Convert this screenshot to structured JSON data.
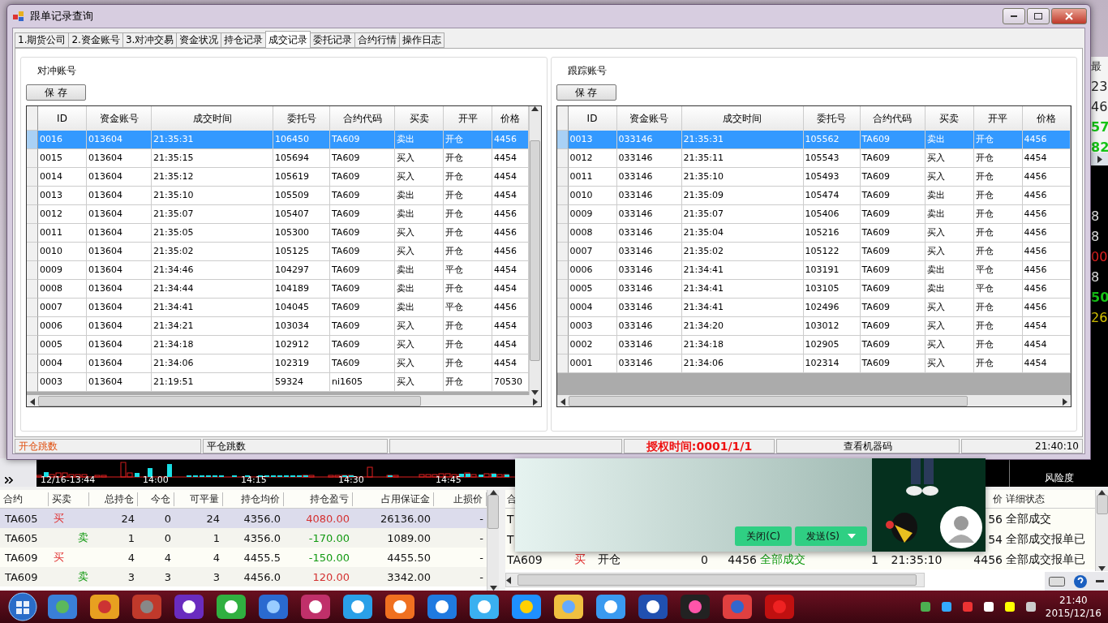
{
  "background_app": {
    "right_strip": {
      "header": "最",
      "values": [
        {
          "text": "23",
          "kind": "plain"
        },
        {
          "text": "46",
          "kind": "plain"
        },
        {
          "text": "57",
          "kind": "up"
        },
        {
          "text": "82",
          "kind": "up"
        }
      ],
      "lower_values": [
        {
          "text": "8",
          "kind": "plain"
        },
        {
          "text": "8",
          "kind": "plain"
        },
        {
          "text": "00",
          "kind": "down"
        },
        {
          "text": "8",
          "kind": "plain"
        },
        {
          "text": "50",
          "kind": "up"
        },
        {
          "text": "26",
          "kind": "warn"
        }
      ]
    },
    "chart": {
      "time_labels": [
        "12/16-13:44",
        "14:00",
        "14:15",
        "14:30",
        "14:45"
      ]
    },
    "risk_label": "风险度",
    "positions": {
      "columns": [
        "合约",
        "买卖",
        "总持仓",
        "今仓",
        "可平量",
        "持仓均价",
        "持仓盈亏",
        "占用保证金",
        "止损价"
      ],
      "rows": [
        {
          "selected": true,
          "cells": [
            {
              "text": "TA605",
              "kind": "plain"
            },
            {
              "text": "买",
              "kind": "buy"
            },
            {
              "text": "24",
              "kind": "plain"
            },
            {
              "text": "0",
              "kind": "plain"
            },
            {
              "text": "24",
              "kind": "plain"
            },
            {
              "text": "4356.0",
              "kind": "plain"
            },
            {
              "text": "4080.00",
              "kind": "profit"
            },
            {
              "text": "26136.00",
              "kind": "plain"
            },
            {
              "text": "-",
              "kind": "plain"
            }
          ]
        },
        {
          "selected": false,
          "cells": [
            {
              "text": "TA605",
              "kind": "plain"
            },
            {
              "text": "卖",
              "kind": "sell"
            },
            {
              "text": "1",
              "kind": "plain"
            },
            {
              "text": "0",
              "kind": "plain"
            },
            {
              "text": "1",
              "kind": "plain"
            },
            {
              "text": "4356.0",
              "kind": "plain"
            },
            {
              "text": "-170.00",
              "kind": "loss"
            },
            {
              "text": "1089.00",
              "kind": "plain"
            },
            {
              "text": "-",
              "kind": "plain"
            }
          ]
        },
        {
          "selected": false,
          "cells": [
            {
              "text": "TA609",
              "kind": "plain"
            },
            {
              "text": "买",
              "kind": "buy"
            },
            {
              "text": "4",
              "kind": "plain"
            },
            {
              "text": "4",
              "kind": "plain"
            },
            {
              "text": "4",
              "kind": "plain"
            },
            {
              "text": "4455.5",
              "kind": "plain"
            },
            {
              "text": "-150.00",
              "kind": "loss"
            },
            {
              "text": "4455.50",
              "kind": "plain"
            },
            {
              "text": "-",
              "kind": "plain"
            }
          ]
        },
        {
          "selected": false,
          "cells": [
            {
              "text": "TA609",
              "kind": "plain"
            },
            {
              "text": "卖",
              "kind": "sell"
            },
            {
              "text": "3",
              "kind": "plain"
            },
            {
              "text": "3",
              "kind": "plain"
            },
            {
              "text": "3",
              "kind": "plain"
            },
            {
              "text": "4456.0",
              "kind": "plain"
            },
            {
              "text": "120.00",
              "kind": "profit"
            },
            {
              "text": "3342.00",
              "kind": "plain"
            },
            {
              "text": "-",
              "kind": "plain"
            }
          ]
        }
      ]
    },
    "orders": {
      "columns": [
        "合",
        null,
        null,
        null,
        null,
        null,
        null,
        null,
        "价",
        "详细状态"
      ],
      "rows": [
        {
          "cells": [
            "T",
            null,
            null,
            null,
            null,
            null,
            null,
            null,
            "56",
            "全部成交"
          ]
        },
        {
          "cells": [
            "T",
            null,
            null,
            null,
            null,
            null,
            null,
            null,
            "54",
            "全部成交报单已"
          ]
        },
        {
          "cells": [
            "TA609",
            "买",
            "开仓",
            "0",
            "4456",
            "全部成交",
            "1",
            "21:35:10",
            "4456",
            "全部成交报单已"
          ]
        }
      ]
    }
  },
  "dialog": {
    "title": "跟单记录查询",
    "tabs": [
      {
        "label": "1.期货公司",
        "selected": false
      },
      {
        "label": "2.资金账号",
        "selected": false
      },
      {
        "label": "3.对冲交易",
        "selected": false
      },
      {
        "label": "资金状况",
        "selected": false
      },
      {
        "label": "持仓记录",
        "selected": false
      },
      {
        "label": "成交记录",
        "selected": true
      },
      {
        "label": "委托记录",
        "selected": false
      },
      {
        "label": "合约行情",
        "selected": false
      },
      {
        "label": "操作日志",
        "selected": false
      }
    ],
    "panels": [
      {
        "label": "对冲账号",
        "save_button": "保 存",
        "vertical_scroll": true,
        "columns": [
          "ID",
          "资金账号",
          "成交时间",
          "委托号",
          "合约代码",
          "买卖",
          "开平",
          "价格"
        ],
        "rows": [
          {
            "selected": true,
            "cells": [
              "0016",
              "013604",
              "21:35:31",
              "106450",
              "TA609",
              "卖出",
              "开仓",
              "4456"
            ]
          },
          {
            "selected": false,
            "cells": [
              "0015",
              "013604",
              "21:35:15",
              "105694",
              "TA609",
              "买入",
              "开仓",
              "4454"
            ]
          },
          {
            "selected": false,
            "cells": [
              "0014",
              "013604",
              "21:35:12",
              "105619",
              "TA609",
              "买入",
              "开仓",
              "4454"
            ]
          },
          {
            "selected": false,
            "cells": [
              "0013",
              "013604",
              "21:35:10",
              "105509",
              "TA609",
              "卖出",
              "开仓",
              "4454"
            ]
          },
          {
            "selected": false,
            "cells": [
              "0012",
              "013604",
              "21:35:07",
              "105407",
              "TA609",
              "卖出",
              "开仓",
              "4456"
            ]
          },
          {
            "selected": false,
            "cells": [
              "0011",
              "013604",
              "21:35:05",
              "105300",
              "TA609",
              "买入",
              "开仓",
              "4456"
            ]
          },
          {
            "selected": false,
            "cells": [
              "0010",
              "013604",
              "21:35:02",
              "105125",
              "TA609",
              "买入",
              "开仓",
              "4456"
            ]
          },
          {
            "selected": false,
            "cells": [
              "0009",
              "013604",
              "21:34:46",
              "104297",
              "TA609",
              "卖出",
              "平仓",
              "4454"
            ]
          },
          {
            "selected": false,
            "cells": [
              "0008",
              "013604",
              "21:34:44",
              "104189",
              "TA609",
              "卖出",
              "开仓",
              "4454"
            ]
          },
          {
            "selected": false,
            "cells": [
              "0007",
              "013604",
              "21:34:41",
              "104045",
              "TA609",
              "卖出",
              "平仓",
              "4456"
            ]
          },
          {
            "selected": false,
            "cells": [
              "0006",
              "013604",
              "21:34:21",
              "103034",
              "TA609",
              "买入",
              "开仓",
              "4454"
            ]
          },
          {
            "selected": false,
            "cells": [
              "0005",
              "013604",
              "21:34:18",
              "102912",
              "TA609",
              "买入",
              "开仓",
              "4454"
            ]
          },
          {
            "selected": false,
            "cells": [
              "0004",
              "013604",
              "21:34:06",
              "102319",
              "TA609",
              "买入",
              "开仓",
              "4454"
            ]
          },
          {
            "selected": false,
            "cells": [
              "0003",
              "013604",
              "21:19:51",
              "59324",
              "ni1605",
              "买入",
              "开仓",
              "70530"
            ]
          }
        ]
      },
      {
        "label": "跟踪账号",
        "save_button": "保 存",
        "vertical_scroll": false,
        "columns": [
          "ID",
          "资金账号",
          "成交时间",
          "委托号",
          "合约代码",
          "买卖",
          "开平",
          "价格"
        ],
        "rows": [
          {
            "selected": true,
            "cells": [
              "0013",
              "033146",
              "21:35:31",
              "105562",
              "TA609",
              "卖出",
              "开仓",
              "4456"
            ]
          },
          {
            "selected": false,
            "cells": [
              "0012",
              "033146",
              "21:35:11",
              "105543",
              "TA609",
              "买入",
              "开仓",
              "4454"
            ]
          },
          {
            "selected": false,
            "cells": [
              "0011",
              "033146",
              "21:35:10",
              "105493",
              "TA609",
              "买入",
              "开仓",
              "4456"
            ]
          },
          {
            "selected": false,
            "cells": [
              "0010",
              "033146",
              "21:35:09",
              "105474",
              "TA609",
              "卖出",
              "开仓",
              "4456"
            ]
          },
          {
            "selected": false,
            "cells": [
              "0009",
              "033146",
              "21:35:07",
              "105406",
              "TA609",
              "卖出",
              "开仓",
              "4456"
            ]
          },
          {
            "selected": false,
            "cells": [
              "0008",
              "033146",
              "21:35:04",
              "105216",
              "TA609",
              "买入",
              "开仓",
              "4456"
            ]
          },
          {
            "selected": false,
            "cells": [
              "0007",
              "033146",
              "21:35:02",
              "105122",
              "TA609",
              "买入",
              "开仓",
              "4456"
            ]
          },
          {
            "selected": false,
            "cells": [
              "0006",
              "033146",
              "21:34:41",
              "103191",
              "TA609",
              "卖出",
              "平仓",
              "4456"
            ]
          },
          {
            "selected": false,
            "cells": [
              "0005",
              "033146",
              "21:34:41",
              "103105",
              "TA609",
              "卖出",
              "平仓",
              "4456"
            ]
          },
          {
            "selected": false,
            "cells": [
              "0004",
              "033146",
              "21:34:41",
              "102496",
              "TA609",
              "买入",
              "开仓",
              "4456"
            ]
          },
          {
            "selected": false,
            "cells": [
              "0003",
              "033146",
              "21:34:20",
              "103012",
              "TA609",
              "买入",
              "开仓",
              "4454"
            ]
          },
          {
            "selected": false,
            "cells": [
              "0002",
              "033146",
              "21:34:18",
              "102905",
              "TA609",
              "买入",
              "开仓",
              "4454"
            ]
          },
          {
            "selected": false,
            "cells": [
              "0001",
              "033146",
              "21:34:06",
              "102314",
              "TA609",
              "买入",
              "开仓",
              "4454"
            ]
          }
        ]
      }
    ],
    "status_bar": [
      {
        "text": "开仓跳数",
        "kind": "warn"
      },
      {
        "text": "平仓跳数",
        "kind": "plain"
      },
      {
        "kind": "empty"
      },
      {
        "text": "授权时间:0001/1/1",
        "kind": "alert"
      },
      {
        "text": "查看机器码",
        "kind": "center"
      },
      {
        "text": "21:40:10",
        "kind": "right"
      }
    ]
  },
  "chat_popup": {
    "buttons": [
      {
        "label": "关闭(C)",
        "dropdown": false
      },
      {
        "label": "发送(S)",
        "dropdown": true
      }
    ]
  },
  "taskbar": {
    "clock": {
      "time": "21:40",
      "date": "2015/12/16"
    }
  }
}
